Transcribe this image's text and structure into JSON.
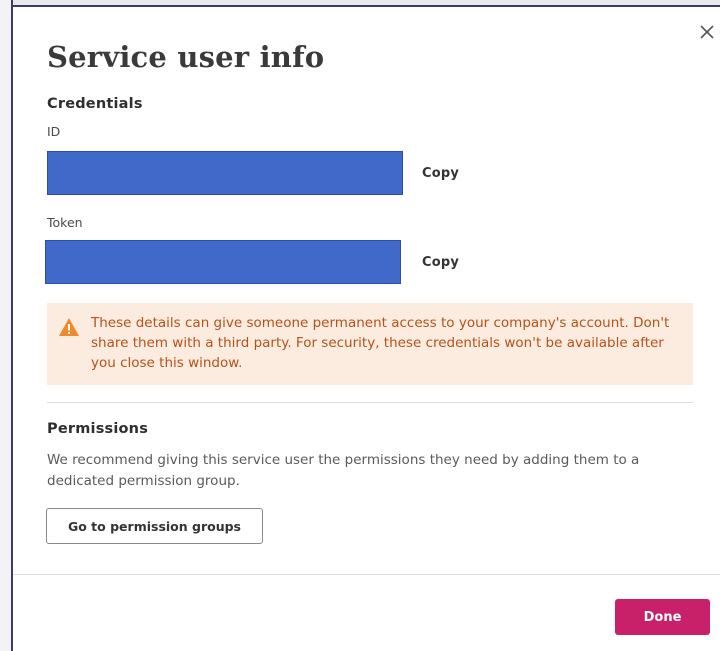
{
  "dialog": {
    "title": "Service user info",
    "close_icon": "close-icon"
  },
  "credentials": {
    "heading": "Credentials",
    "id": {
      "label": "ID",
      "value": "",
      "copy_label": "Copy"
    },
    "token": {
      "label": "Token",
      "value": "",
      "copy_label": "Copy"
    },
    "redaction_color": "#4169c9"
  },
  "warning": {
    "icon": "warning-triangle-icon",
    "text": "These details can give someone permanent access to your company's account. Don't share them with a third party. For security, these credentials won't be available after you close this window.",
    "background_color": "#fbecdf",
    "text_color": "#b5521c"
  },
  "permissions": {
    "heading": "Permissions",
    "description": "We recommend giving this service user the permissions they need by adding them to a dedicated permission group.",
    "button_label": "Go to permission groups"
  },
  "footer": {
    "done_label": "Done",
    "accent_color": "#c9206a"
  }
}
